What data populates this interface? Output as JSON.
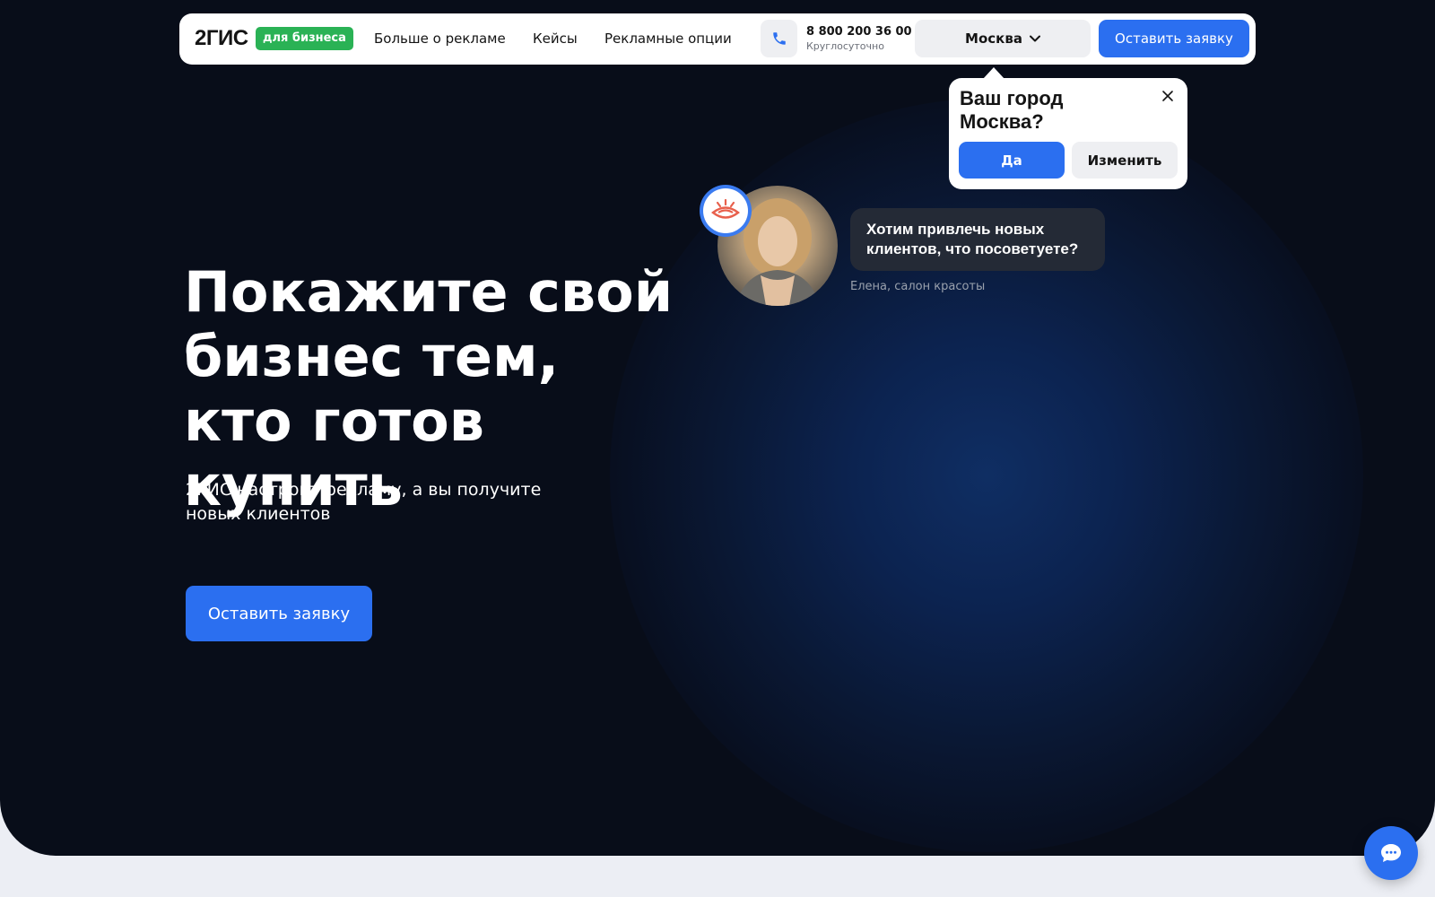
{
  "header": {
    "logo_text": "2ГИС",
    "logo_badge": "для бизнеса",
    "nav": [
      {
        "label": "Больше о рекламе"
      },
      {
        "label": "Кейсы"
      },
      {
        "label": "Рекламные опции"
      }
    ],
    "phone_number": "8 800 200 36 00",
    "phone_hours": "Круглосуточно",
    "city": "Москва",
    "cta_label": "Оставить заявку"
  },
  "city_popup": {
    "title": "Ваш город Москва?",
    "yes_label": "Да",
    "change_label": "Изменить"
  },
  "testimonial": {
    "quote": "Хотим привлечь новых клиентов, что посоветуете?",
    "author": "Елена, салон красоты"
  },
  "hero": {
    "headline": "Покажите свой бизнес тем, кто готов купить",
    "subline": "2ГИС настроит рекламу, а вы получите новых клиентов",
    "cta_label": "Оставить заявку"
  },
  "colors": {
    "hero_background": "#080d19",
    "accent_blue": "#2b6ff0",
    "badge_green": "#2ab255",
    "page_background": "#eceef4"
  },
  "icons": [
    "phone-icon",
    "chevron-down-icon",
    "close-icon",
    "beauty-salon-icon",
    "chat-icon"
  ]
}
